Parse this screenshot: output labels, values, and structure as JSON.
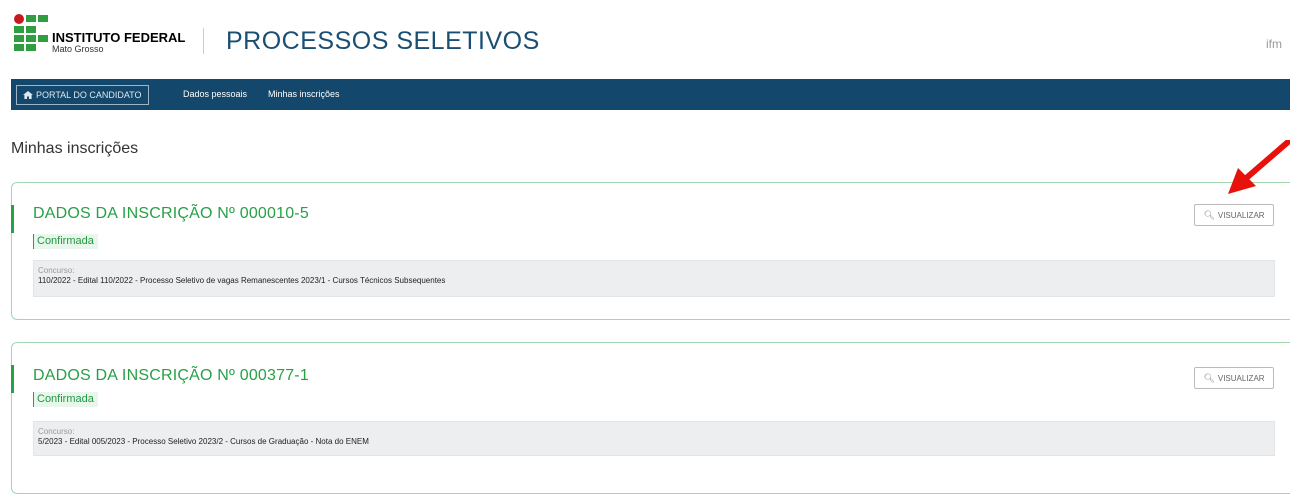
{
  "header": {
    "logo_title": "INSTITUTO FEDERAL",
    "logo_subtitle": "Mato Grosso",
    "site_title": "PROCESSOS SELETIVOS",
    "user_text": "ifm"
  },
  "nav": {
    "portal_label": "PORTAL DO CANDIDATO",
    "items": [
      {
        "label": "Dados pessoais"
      },
      {
        "label": "Minhas inscrições"
      }
    ]
  },
  "page": {
    "title": "Minhas inscrições"
  },
  "cards": [
    {
      "title": "DADOS DA INSCRIÇÃO Nº 000010-5",
      "status": "Confirmada",
      "concurso_label": "Concurso:",
      "concurso_value": "110/2022 - Edital 110/2022 - Processo Seletivo de vagas Remanescentes 2023/1 - Cursos Técnicos Subsequentes",
      "button_label": "VISUALIZAR"
    },
    {
      "title": "DADOS DA INSCRIÇÃO Nº 000377-1",
      "status": "Confirmada",
      "concurso_label": "Concurso:",
      "concurso_value": "5/2023 - Edital 005/2023 - Processo Seletivo 2023/2 - Cursos de Graduação - Nota do ENEM",
      "button_label": "VISUALIZAR"
    }
  ],
  "icons": {
    "home": "home-icon",
    "search": "search-icon",
    "annotation": "red-arrow-annotation"
  },
  "colors": {
    "nav_bg": "#13476b",
    "brand_green": "#27a046",
    "logo_red": "#c8191e",
    "title_blue": "#1a4e73",
    "annotation_red": "#e8120c"
  }
}
